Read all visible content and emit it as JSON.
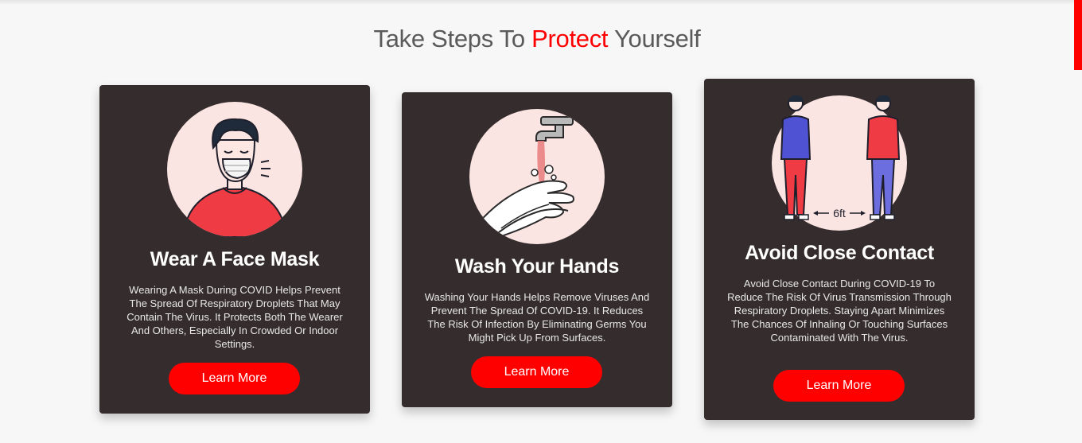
{
  "section": {
    "title_prefix": "Take Steps To ",
    "title_accent": "Protect",
    "title_suffix": " Yourself"
  },
  "colors": {
    "accent": "#ff0000",
    "card_bg": "#352c2d",
    "circle_bg": "#fbe5e3",
    "title_gray": "#5a5a5a"
  },
  "cards": [
    {
      "title": "Wear A Face Mask",
      "description": "Wearing A Mask During COVID Helps Prevent The Spread Of Respiratory Droplets That May Contain The Virus. It Protects Both The Wearer And Others, Especially In Crowded Or Indoor Settings.",
      "button_label": "Learn More",
      "image": "face-mask-illustration"
    },
    {
      "title": "Wash Your Hands",
      "description": "Washing Your Hands Helps Remove Viruses And Prevent The Spread Of COVID-19. It Reduces The Risk Of Infection By Eliminating Germs You Might Pick Up From Surfaces.",
      "button_label": "Learn More",
      "image": "hand-washing-illustration"
    },
    {
      "title": "Avoid Close Contact",
      "description": "Avoid Close Contact During COVID-19 To Reduce The Risk Of Virus Transmission Through Respiratory Droplets. Staying Apart Minimizes The Chances Of Inhaling Or Touching Surfaces Contaminated With The Virus.",
      "button_label": "Learn More",
      "image": "social-distance-illustration",
      "distance_label": "6ft"
    }
  ]
}
